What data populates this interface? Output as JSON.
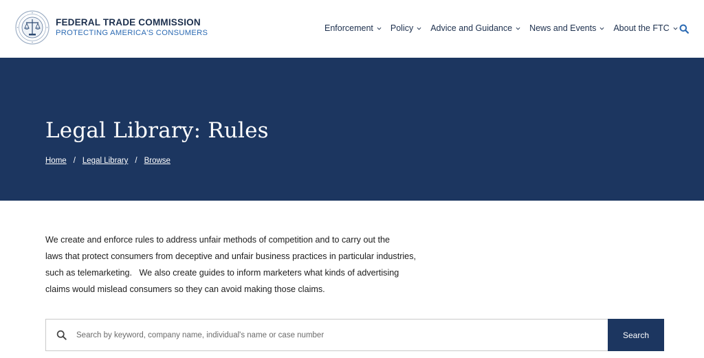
{
  "brand": {
    "name": "FEDERAL TRADE COMMISSION",
    "tagline": "PROTECTING AMERICA'S CONSUMERS"
  },
  "nav": {
    "items": [
      {
        "label": "Enforcement"
      },
      {
        "label": "Policy"
      },
      {
        "label": "Advice and Guidance"
      },
      {
        "label": "News and Events"
      },
      {
        "label": "About the FTC"
      }
    ]
  },
  "hero": {
    "title": "Legal Library: Rules",
    "breadcrumb": [
      {
        "label": "Home"
      },
      {
        "label": "Legal Library"
      },
      {
        "label": "Browse"
      }
    ],
    "separator": "/"
  },
  "intro": {
    "lines": [
      "We create and enforce rules to address unfair methods of competition and to carry out the",
      "laws that protect consumers from deceptive and unfair business practices in particular industries,",
      "such as telemarketing.   We also create guides to inform marketers what kinds of advertising",
      "claims would mislead consumers so they can avoid making those claims."
    ]
  },
  "search": {
    "placeholder": "Search by keyword, company name, individual's name or case number",
    "value": "",
    "button_label": "Search"
  },
  "colors": {
    "navy": "#1c3660",
    "brand_text": "#1c2f4d",
    "accent_blue": "#2b6ab3"
  },
  "icons": {
    "seal": "ftc-seal-icon",
    "search": "search-icon",
    "chevron": "chevron-down-icon"
  }
}
